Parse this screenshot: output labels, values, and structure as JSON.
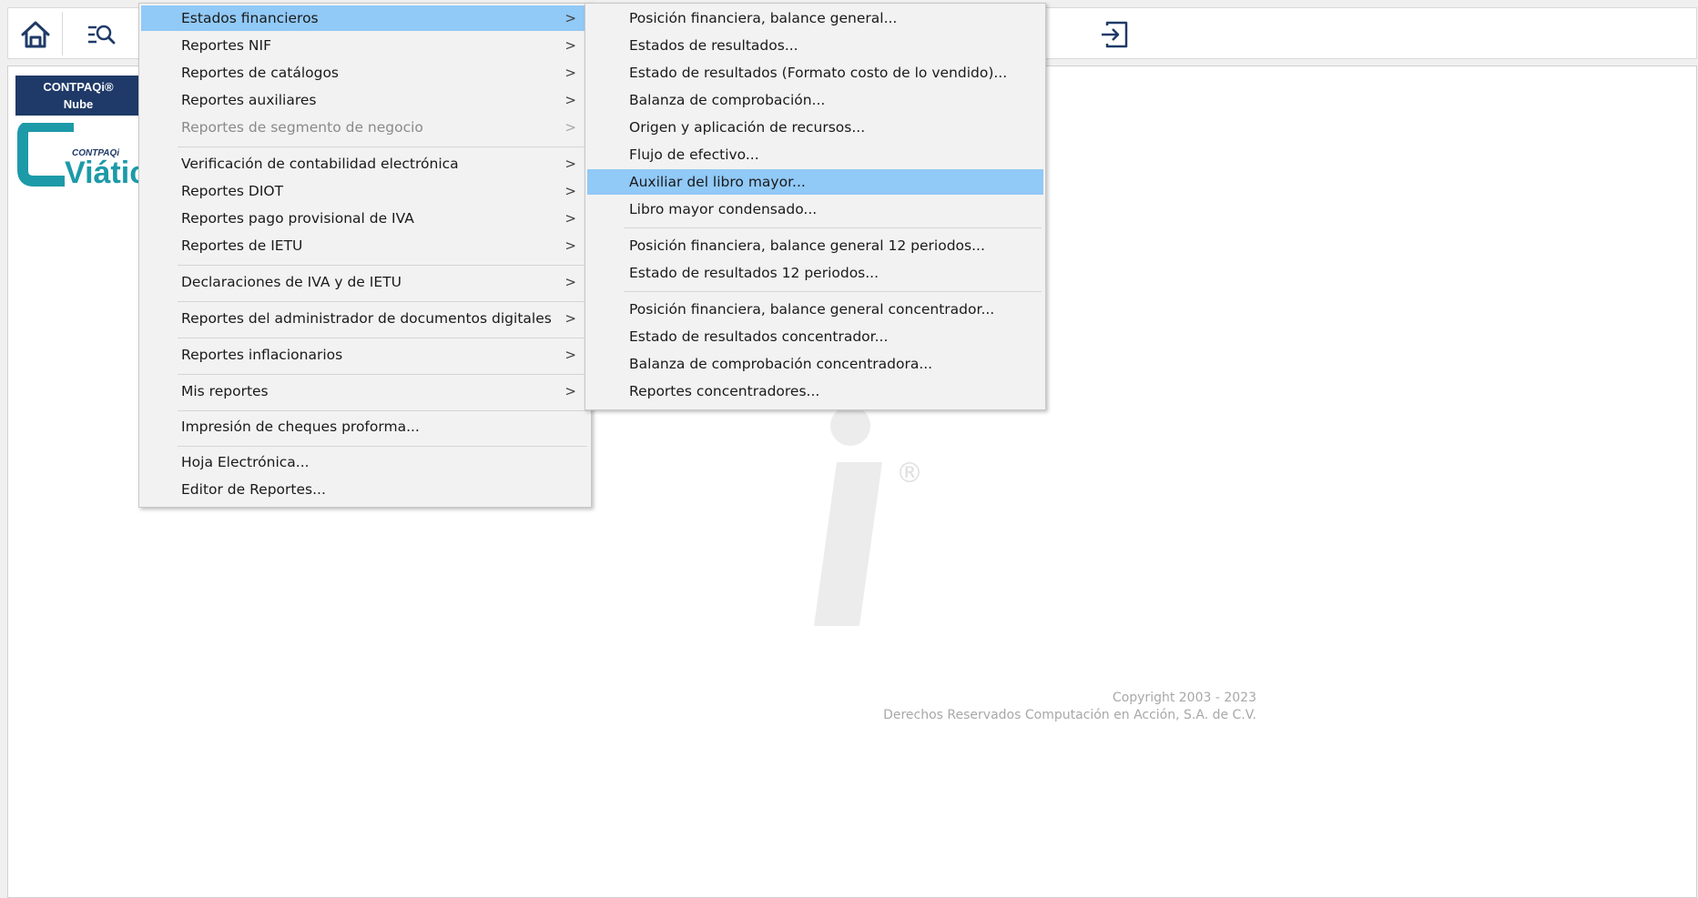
{
  "toolbar": {
    "home_icon": "home-icon",
    "search_icon": "list-search-icon",
    "exit_icon": "sign-out-icon"
  },
  "brand": {
    "line1": "CONTPAQi®",
    "line2": "Nube",
    "logo_small": "CONTPAQi",
    "logo_big": "Viátic"
  },
  "main_menu": {
    "items": [
      {
        "label": "Estados financieros",
        "chevron": ">"
      },
      {
        "label": "Reportes NIF",
        "chevron": ">"
      },
      {
        "label": "Reportes de catálogos",
        "chevron": ">"
      },
      {
        "label": "Reportes auxiliares",
        "chevron": ">"
      },
      {
        "label": "Reportes de segmento de negocio",
        "chevron": ">"
      },
      {
        "label": "Verificación de contabilidad electrónica",
        "chevron": ">"
      },
      {
        "label": "Reportes DIOT",
        "chevron": ">"
      },
      {
        "label": "Reportes pago provisional de IVA",
        "chevron": ">"
      },
      {
        "label": "Reportes de IETU",
        "chevron": ">"
      },
      {
        "label": "Declaraciones de IVA y de IETU",
        "chevron": ">"
      },
      {
        "label": "Reportes del administrador de documentos digitales",
        "chevron": ">"
      },
      {
        "label": "Reportes inflacionarios",
        "chevron": ">"
      },
      {
        "label": "Mis reportes",
        "chevron": ">"
      },
      {
        "label": "Impresión de cheques proforma..."
      },
      {
        "label": "Hoja Electrónica..."
      },
      {
        "label": "Editor de Reportes..."
      }
    ]
  },
  "sub_menu": {
    "items": [
      {
        "label": "Posición financiera, balance general..."
      },
      {
        "label": "Estados de resultados..."
      },
      {
        "label": "Estado de resultados (Formato costo de lo vendido)..."
      },
      {
        "label": "Balanza de comprobación..."
      },
      {
        "label": "Origen y aplicación de recursos..."
      },
      {
        "label": "Flujo de efectivo..."
      },
      {
        "label": "Auxiliar del libro mayor..."
      },
      {
        "label": "Libro mayor condensado..."
      },
      {
        "label": "Posición financiera, balance general 12 periodos..."
      },
      {
        "label": "Estado de resultados 12 periodos..."
      },
      {
        "label": "Posición financiera, balance general concentrador..."
      },
      {
        "label": "Estado de resultados concentrador..."
      },
      {
        "label": "Balanza de comprobación concentradora..."
      },
      {
        "label": "Reportes concentradores..."
      }
    ]
  },
  "watermark": {
    "registered": "®"
  },
  "copyright": {
    "line1": "Copyright 2003 - 2023",
    "line2": "Derechos Reservados Computación en Acción, S.A. de C.V."
  },
  "colors": {
    "highlight": "#91c9f7",
    "brand_navy": "#1f3a68",
    "brand_teal": "#1d9aa8"
  }
}
